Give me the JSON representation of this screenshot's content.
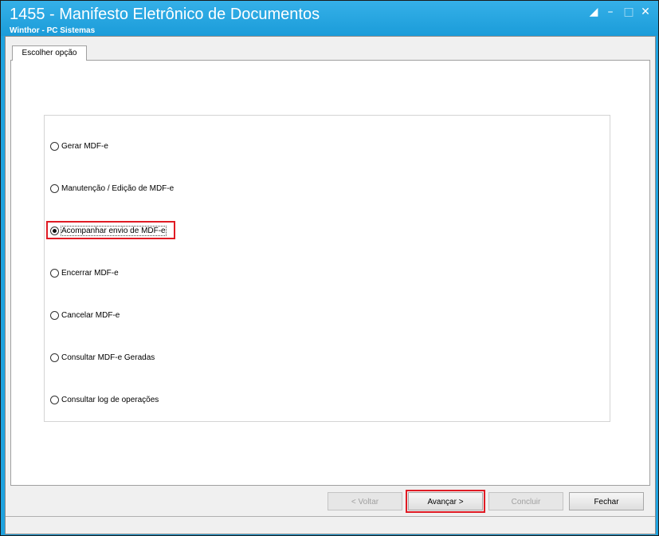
{
  "window": {
    "title": "1455 - Manifesto Eletrônico de Documentos",
    "subtitle": "Winthor - PC Sistemas",
    "controls": [
      "restore-icon",
      "minimize-icon",
      "maximize-icon",
      "close-icon"
    ]
  },
  "tabs": [
    {
      "label": "Escolher opção",
      "active": true
    }
  ],
  "options": [
    {
      "label": "Gerar MDF-e",
      "selected": false
    },
    {
      "label": "Manutenção / Edição de MDF-e",
      "selected": false
    },
    {
      "label": "Acompanhar envio de MDF-e",
      "selected": true
    },
    {
      "label": "Encerrar MDF-e",
      "selected": false
    },
    {
      "label": "Cancelar MDF-e",
      "selected": false
    },
    {
      "label": "Consultar MDF-e Geradas",
      "selected": false
    },
    {
      "label": "Consultar log de operações",
      "selected": false
    }
  ],
  "buttons": {
    "back": "< Voltar",
    "next": "Avançar >",
    "finish": "Concluir",
    "close": "Fechar"
  },
  "colors": {
    "titlebar": "#1b9cd9",
    "highlight": "#e01b24"
  }
}
